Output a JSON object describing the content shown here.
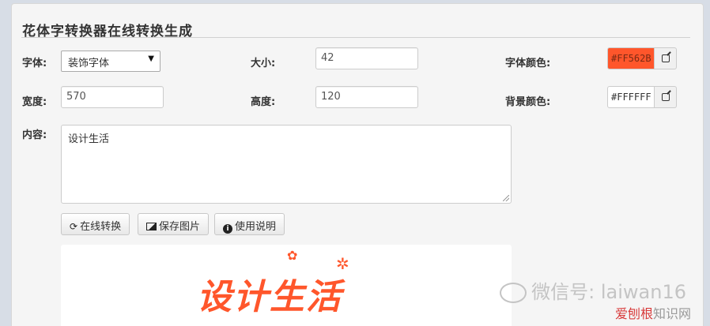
{
  "page": {
    "title": "花体字转换器在线转换生成"
  },
  "form": {
    "font_label": "字体:",
    "font_value": "装饰字体",
    "size_label": "大小:",
    "size_value": "42",
    "font_color_label": "字体颜色:",
    "font_color_value": "#FF562B",
    "width_label": "宽度:",
    "width_value": "570",
    "height_label": "高度:",
    "height_value": "120",
    "bg_color_label": "背景颜色:",
    "bg_color_value": "#FFFFFF",
    "content_label": "内容:",
    "content_value": "设计生活"
  },
  "buttons": {
    "convert_label": "在线转换",
    "save_label": "保存图片",
    "help_label": "使用说明"
  },
  "preview": {
    "text": "设计生活"
  },
  "watermark": {
    "text": "微信号: laiwan16",
    "site_part1": "爱刨根",
    "site_part2": "知识网"
  },
  "colors": {
    "font_color": "#FF562B",
    "bg_color": "#FFFFFF",
    "site_red": "#d83a3a",
    "site_gray": "#999999"
  },
  "icons": [
    "refresh-icon",
    "picture-icon",
    "info-icon",
    "edit-icon",
    "chevron-down-icon",
    "wechat-icon"
  ]
}
